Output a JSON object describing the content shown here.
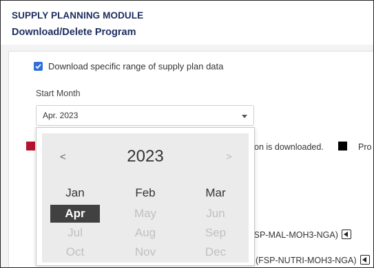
{
  "header": {
    "module_title": "SUPPLY PLANNING MODULE",
    "page_title": "Download/Delete Program"
  },
  "options": {
    "download_range_label": "Download specific range of supply plan data",
    "download_range_checked": true
  },
  "start_month": {
    "label": "Start Month",
    "value": "Apr. 2023"
  },
  "legend": {
    "text1": "on is downloaded.",
    "text2": "Pro",
    "colors": {
      "red": "#b4142d",
      "black": "#000000"
    }
  },
  "list": {
    "row1": "FSP-MAL-MOH3-NGA)",
    "row2": "(FSP-NUTRI-MOH3-NGA)"
  },
  "picker": {
    "year": "2023",
    "prev": "<",
    "next": ">",
    "months": [
      "Jan",
      "Feb",
      "Mar",
      "Apr",
      "May",
      "Jun",
      "Jul",
      "Aug",
      "Sep",
      "Oct",
      "Nov",
      "Dec"
    ],
    "selected": "Apr",
    "enabled": [
      "Jan",
      "Feb",
      "Mar",
      "Apr"
    ]
  },
  "icons": {
    "checkbox": "checkmark-icon",
    "dropdown": "chevron-down-icon",
    "collapse": "caret-left-icon"
  }
}
